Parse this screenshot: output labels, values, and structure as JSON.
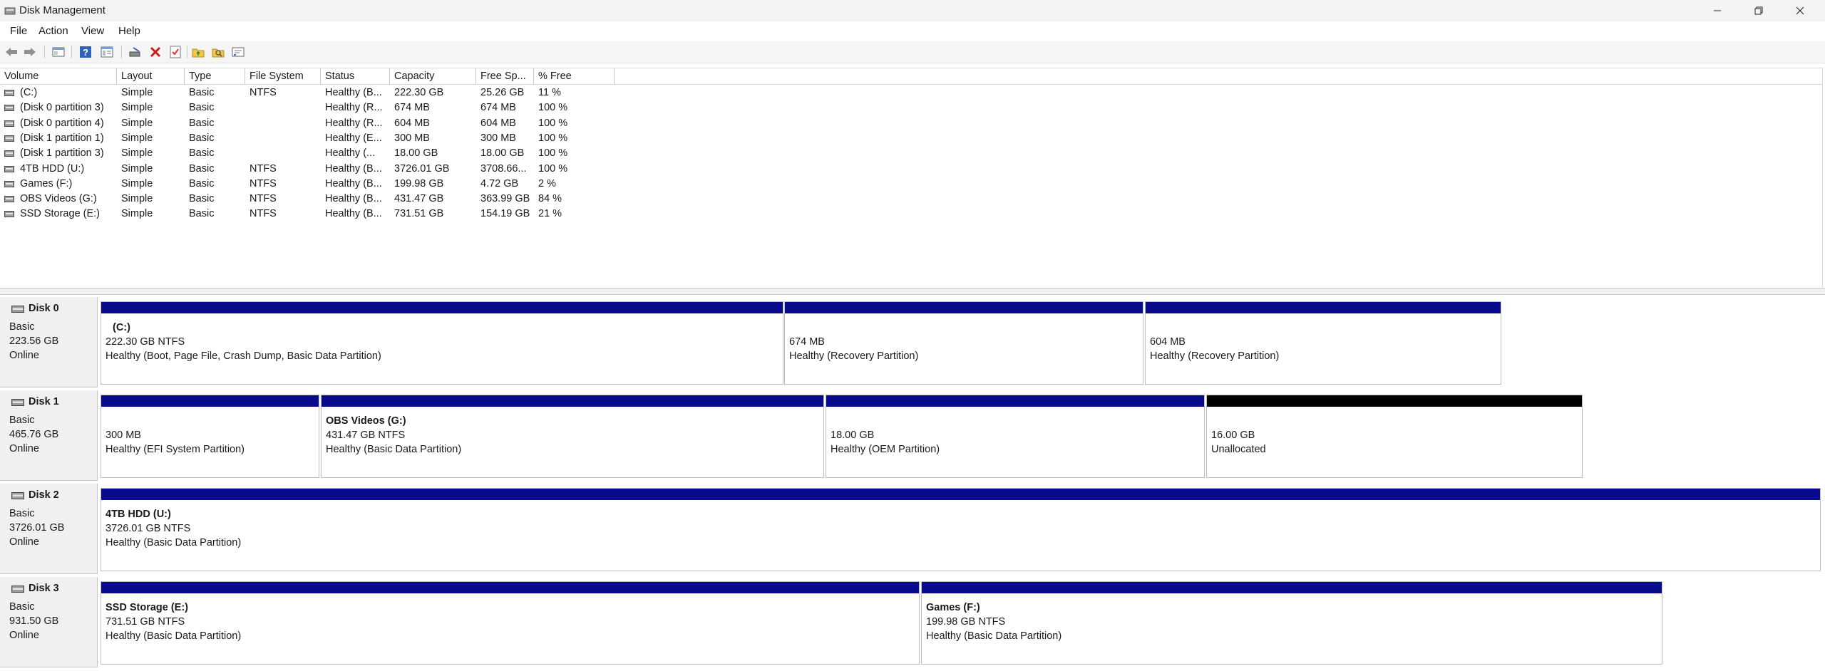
{
  "window": {
    "title": "Disk Management",
    "icons": {
      "app": "disk-management-icon",
      "minimize": "minimize-icon",
      "maximize": "restore-icon",
      "close": "close-icon"
    }
  },
  "menu": {
    "items": [
      "File",
      "Action",
      "View",
      "Help"
    ]
  },
  "toolbar": {
    "buttons": [
      "back-arrow-icon",
      "forward-arrow-icon",
      "console-tree-icon",
      "help-icon",
      "properties-list-icon",
      "connect-drive-icon",
      "delete-icon",
      "check-properties-icon",
      "folder-up-icon",
      "folder-search-icon",
      "settings-panel-icon"
    ]
  },
  "volume_table": {
    "columns": [
      "Volume",
      "Layout",
      "Type",
      "File System",
      "Status",
      "Capacity",
      "Free Sp...",
      "% Free"
    ],
    "rows": [
      [
        "(C:)",
        "Simple",
        "Basic",
        "NTFS",
        "Healthy (B...",
        "222.30 GB",
        "25.26 GB",
        "11 %"
      ],
      [
        "(Disk 0 partition 3)",
        "Simple",
        "Basic",
        "",
        "Healthy (R...",
        "674 MB",
        "674 MB",
        "100 %"
      ],
      [
        "(Disk 0 partition 4)",
        "Simple",
        "Basic",
        "",
        "Healthy (R...",
        "604 MB",
        "604 MB",
        "100 %"
      ],
      [
        "(Disk 1 partition 1)",
        "Simple",
        "Basic",
        "",
        "Healthy (E...",
        "300 MB",
        "300 MB",
        "100 %"
      ],
      [
        "(Disk 1 partition 3)",
        "Simple",
        "Basic",
        "",
        "Healthy (...",
        "18.00 GB",
        "18.00 GB",
        "100 %"
      ],
      [
        "4TB HDD (U:)",
        "Simple",
        "Basic",
        "NTFS",
        "Healthy (B...",
        "3726.01 GB",
        "3708.66...",
        "100 %"
      ],
      [
        "Games (F:)",
        "Simple",
        "Basic",
        "NTFS",
        "Healthy (B...",
        "199.98 GB",
        "4.72 GB",
        "2 %"
      ],
      [
        "OBS Videos (G:)",
        "Simple",
        "Basic",
        "NTFS",
        "Healthy (B...",
        "431.47 GB",
        "363.99 GB",
        "84 %"
      ],
      [
        "SSD Storage (E:)",
        "Simple",
        "Basic",
        "NTFS",
        "Healthy (B...",
        "731.51 GB",
        "154.19 GB",
        "21 %"
      ]
    ]
  },
  "disks": [
    {
      "name": "Disk 0",
      "type": "Basic",
      "size": "223.56 GB",
      "status": "Online",
      "partitions": [
        {
          "title": "(C:)",
          "size": "222.30 GB NTFS",
          "status": "Healthy (Boot, Page File, Crash Dump, Basic Data Partition)"
        },
        {
          "title": "",
          "size": "674 MB",
          "status": "Healthy (Recovery Partition)"
        },
        {
          "title": "",
          "size": "604 MB",
          "status": "Healthy (Recovery Partition)"
        }
      ]
    },
    {
      "name": "Disk 1",
      "type": "Basic",
      "size": "465.76 GB",
      "status": "Online",
      "partitions": [
        {
          "title": "",
          "size": "300 MB",
          "status": "Healthy (EFI System Partition)"
        },
        {
          "title": "OBS Videos  (G:)",
          "size": "431.47 GB NTFS",
          "status": "Healthy (Basic Data Partition)"
        },
        {
          "title": "",
          "size": "18.00 GB",
          "status": "Healthy (OEM Partition)"
        },
        {
          "title": "",
          "size": "16.00 GB",
          "status": "Unallocated",
          "unallocated": true
        }
      ]
    },
    {
      "name": "Disk 2",
      "type": "Basic",
      "size": "3726.01 GB",
      "status": "Online",
      "partitions": [
        {
          "title": "4TB HDD  (U:)",
          "size": "3726.01 GB NTFS",
          "status": "Healthy (Basic Data Partition)"
        }
      ]
    },
    {
      "name": "Disk 3",
      "type": "Basic",
      "size": "931.50 GB",
      "status": "Online",
      "partitions": [
        {
          "title": "SSD Storage  (E:)",
          "size": "731.51 GB NTFS",
          "status": "Healthy (Basic Data Partition)"
        },
        {
          "title": "Games  (F:)",
          "size": "199.98 GB NTFS",
          "status": "Healthy (Basic Data Partition)"
        }
      ]
    }
  ],
  "colors": {
    "primary_partition": "#0a0a8c",
    "unallocated": "#000000"
  }
}
